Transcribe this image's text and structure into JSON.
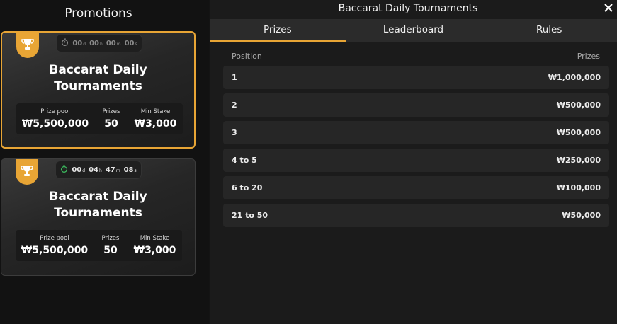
{
  "left": {
    "title": "Promotions",
    "cards": [
      {
        "timer": {
          "d": "00",
          "h": "00",
          "m": "00",
          "s": "00",
          "color": "#8a8a8a"
        },
        "title_line1": "Baccarat Daily",
        "title_line2": "Tournaments",
        "prize_pool_label": "Prize pool",
        "prize_pool": "₩5,500,000",
        "prizes_label": "Prizes",
        "prizes": "50",
        "min_stake_label": "Min Stake",
        "min_stake": "₩3,000"
      },
      {
        "timer": {
          "d": "00",
          "h": "04",
          "m": "47",
          "s": "08",
          "color": "#3cc060"
        },
        "title_line1": "Baccarat Daily",
        "title_line2": "Tournaments",
        "prize_pool_label": "Prize pool",
        "prize_pool": "₩5,500,000",
        "prizes_label": "Prizes",
        "prizes": "50",
        "min_stake_label": "Min Stake",
        "min_stake": "₩3,000"
      }
    ],
    "unit_labels": {
      "d": "d",
      "h": "h",
      "m": "m",
      "s": "s"
    }
  },
  "right": {
    "title": "Baccarat Daily Tournaments",
    "tabs": [
      "Prizes",
      "Leaderboard",
      "Rules"
    ],
    "active_tab": "Prizes",
    "header": {
      "position": "Position",
      "prizes": "Prizes"
    },
    "rows": [
      {
        "position": "1",
        "prize": "₩1,000,000"
      },
      {
        "position": "2",
        "prize": "₩500,000"
      },
      {
        "position": "3",
        "prize": "₩500,000"
      },
      {
        "position": "4 to 5",
        "prize": "₩250,000"
      },
      {
        "position": "6 to 20",
        "prize": "₩100,000"
      },
      {
        "position": "21 to 50",
        "prize": "₩50,000"
      }
    ]
  },
  "colors": {
    "accent": "#e8a535",
    "timer_active": "#3cc060"
  },
  "icons": {
    "trophy": "trophy-icon",
    "timer": "stopwatch-icon",
    "close": "close-icon"
  }
}
